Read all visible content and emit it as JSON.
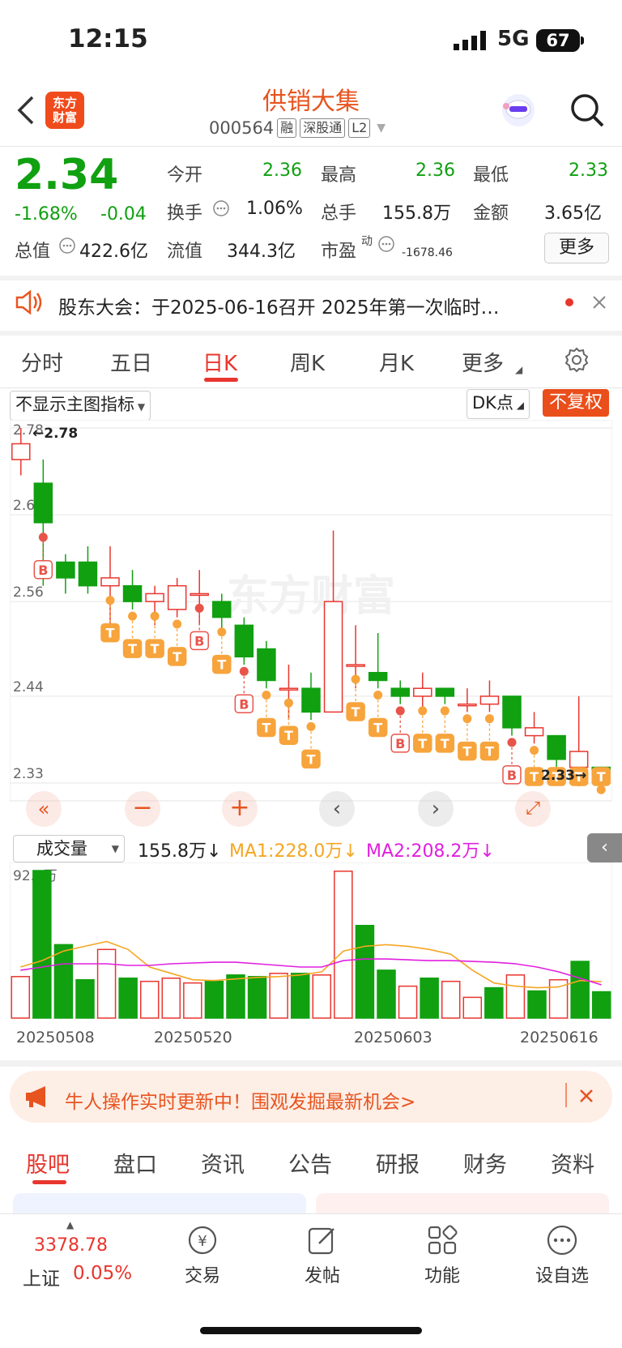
{
  "status": {
    "time": "12:15",
    "network": "5G",
    "battery": "67"
  },
  "header": {
    "logo_line1": "东方",
    "logo_line2": "财富",
    "title": "供销大集",
    "code": "000564",
    "tags": [
      "融",
      "深股通",
      "L2"
    ]
  },
  "quote": {
    "price": "2.34",
    "change_pct": "-1.68%",
    "change": "-0.04",
    "rows": [
      [
        {
          "label": "今开",
          "value": "2.36"
        },
        {
          "label": "最高",
          "value": "2.36"
        },
        {
          "label": "最低",
          "value": "2.33"
        }
      ],
      [
        {
          "label": "换手",
          "value": "1.06%"
        },
        {
          "label": "总手",
          "value": "155.8万"
        },
        {
          "label": "金额",
          "value": "3.65亿"
        }
      ],
      [
        {
          "label": "总值",
          "value": "422.6亿"
        },
        {
          "label": "流值",
          "value": "344.3亿"
        },
        {
          "label": "市盈",
          "sup": "动",
          "value": "-1678.46"
        }
      ]
    ],
    "more_label": "更多"
  },
  "notice": {
    "text": "股东大会：于2025-06-16召开 2025年第一次临时…"
  },
  "chart_tabs": {
    "items": [
      "分时",
      "五日",
      "日K",
      "周K",
      "月K",
      "更多"
    ],
    "active": "日K"
  },
  "chart_controls": {
    "indicator_select": "不显示主图指标",
    "dk_select": "DK点",
    "fq_button": "不复权"
  },
  "chart_data": [
    {
      "type": "candlestick",
      "title": "日K",
      "y_ticks": [
        "2.78",
        "2.67",
        "2.56",
        "2.44",
        "2.33"
      ],
      "ylim": [
        2.33,
        2.78
      ],
      "max_label": "2.78",
      "min_label": "2.33",
      "up_color": "#e8362e",
      "down_color": "#10a010",
      "candles": [
        {
          "o": 2.74,
          "c": 2.76,
          "h": 2.78,
          "l": 2.72
        },
        {
          "o": 2.71,
          "c": 2.66,
          "h": 2.74,
          "l": 2.58
        },
        {
          "o": 2.61,
          "c": 2.59,
          "h": 2.62,
          "l": 2.57
        },
        {
          "o": 2.61,
          "c": 2.58,
          "h": 2.63,
          "l": 2.57
        },
        {
          "o": 2.58,
          "c": 2.59,
          "h": 2.63,
          "l": 2.53
        },
        {
          "o": 2.58,
          "c": 2.56,
          "h": 2.6,
          "l": 2.55
        },
        {
          "o": 2.56,
          "c": 2.57,
          "h": 2.58,
          "l": 2.53
        },
        {
          "o": 2.55,
          "c": 2.58,
          "h": 2.59,
          "l": 2.54
        },
        {
          "o": 2.57,
          "c": 2.57,
          "h": 2.6,
          "l": 2.53
        },
        {
          "o": 2.56,
          "c": 2.54,
          "h": 2.57,
          "l": 2.52
        },
        {
          "o": 2.53,
          "c": 2.49,
          "h": 2.54,
          "l": 2.48
        },
        {
          "o": 2.5,
          "c": 2.46,
          "h": 2.51,
          "l": 2.45
        },
        {
          "o": 2.45,
          "c": 2.45,
          "h": 2.48,
          "l": 2.41
        },
        {
          "o": 2.45,
          "c": 2.42,
          "h": 2.47,
          "l": 2.41
        },
        {
          "o": 2.42,
          "c": 2.56,
          "h": 2.65,
          "l": 2.42
        },
        {
          "o": 2.48,
          "c": 2.48,
          "h": 2.53,
          "l": 2.45
        },
        {
          "o": 2.47,
          "c": 2.46,
          "h": 2.52,
          "l": 2.45
        },
        {
          "o": 2.45,
          "c": 2.44,
          "h": 2.46,
          "l": 2.43
        },
        {
          "o": 2.44,
          "c": 2.45,
          "h": 2.47,
          "l": 2.42
        },
        {
          "o": 2.45,
          "c": 2.44,
          "h": 2.45,
          "l": 2.43
        },
        {
          "o": 2.43,
          "c": 2.43,
          "h": 2.45,
          "l": 2.42
        },
        {
          "o": 2.43,
          "c": 2.44,
          "h": 2.46,
          "l": 2.42
        },
        {
          "o": 2.44,
          "c": 2.4,
          "h": 2.44,
          "l": 2.39
        },
        {
          "o": 2.39,
          "c": 2.4,
          "h": 2.42,
          "l": 2.38
        },
        {
          "o": 2.39,
          "c": 2.36,
          "h": 2.39,
          "l": 2.35
        },
        {
          "o": 2.35,
          "c": 2.37,
          "h": 2.44,
          "l": 2.34
        },
        {
          "o": 2.35,
          "c": 2.34,
          "h": 2.35,
          "l": 2.33
        }
      ],
      "signals": [
        {
          "i": 1,
          "type": "B"
        },
        {
          "i": 4,
          "type": "T"
        },
        {
          "i": 5,
          "type": "T"
        },
        {
          "i": 6,
          "type": "T"
        },
        {
          "i": 7,
          "type": "T"
        },
        {
          "i": 8,
          "type": "B"
        },
        {
          "i": 9,
          "type": "T"
        },
        {
          "i": 10,
          "type": "B"
        },
        {
          "i": 11,
          "type": "T"
        },
        {
          "i": 12,
          "type": "T"
        },
        {
          "i": 13,
          "type": "T"
        },
        {
          "i": 15,
          "type": "T"
        },
        {
          "i": 16,
          "type": "T"
        },
        {
          "i": 17,
          "type": "B"
        },
        {
          "i": 18,
          "type": "T"
        },
        {
          "i": 19,
          "type": "T"
        },
        {
          "i": 20,
          "type": "T"
        },
        {
          "i": 21,
          "type": "T"
        },
        {
          "i": 22,
          "type": "B"
        },
        {
          "i": 23,
          "type": "T"
        },
        {
          "i": 24,
          "type": "T"
        },
        {
          "i": 25,
          "type": "T"
        },
        {
          "i": 26,
          "type": "T"
        }
      ]
    },
    {
      "type": "bar",
      "title": "成交量",
      "current": "155.8万",
      "ma1_label": "MA1:228.0万",
      "ma2_label": "MA2:208.2万",
      "ma1_color": "#f5a623",
      "ma2_color": "#e020e0",
      "top_label": "92.4万",
      "x_labels": [
        "20250508",
        "20250520",
        "20250603",
        "20250616"
      ],
      "volumes": [
        260,
        924,
        460,
        240,
        430,
        250,
        230,
        250,
        220,
        230,
        270,
        260,
        280,
        280,
        270,
        920,
        580,
        300,
        200,
        250,
        230,
        130,
        190,
        270,
        170,
        240,
        355,
        165
      ],
      "ma1": [
        320,
        360,
        420,
        450,
        480,
        430,
        320,
        280,
        240,
        235,
        245,
        255,
        260,
        270,
        290,
        420,
        450,
        460,
        450,
        430,
        400,
        300,
        220,
        200,
        190,
        195,
        235,
        228
      ],
      "ma2": [
        300,
        320,
        340,
        340,
        340,
        330,
        330,
        340,
        345,
        350,
        350,
        340,
        330,
        320,
        320,
        360,
        370,
        370,
        365,
        360,
        360,
        355,
        350,
        340,
        320,
        290,
        250,
        208
      ]
    }
  ],
  "banner": {
    "text": "牛人操作实时更新中！围观发掘最新机会>"
  },
  "bottom_tabs": {
    "items": [
      "股吧",
      "盘口",
      "资讯",
      "公告",
      "研报",
      "财务",
      "资料"
    ],
    "active": "股吧"
  },
  "bottom_nav": {
    "index_value": "3378.78",
    "index_name": "上证",
    "index_change": "0.05%",
    "items": [
      "交易",
      "发帖",
      "功能",
      "设自选"
    ]
  }
}
